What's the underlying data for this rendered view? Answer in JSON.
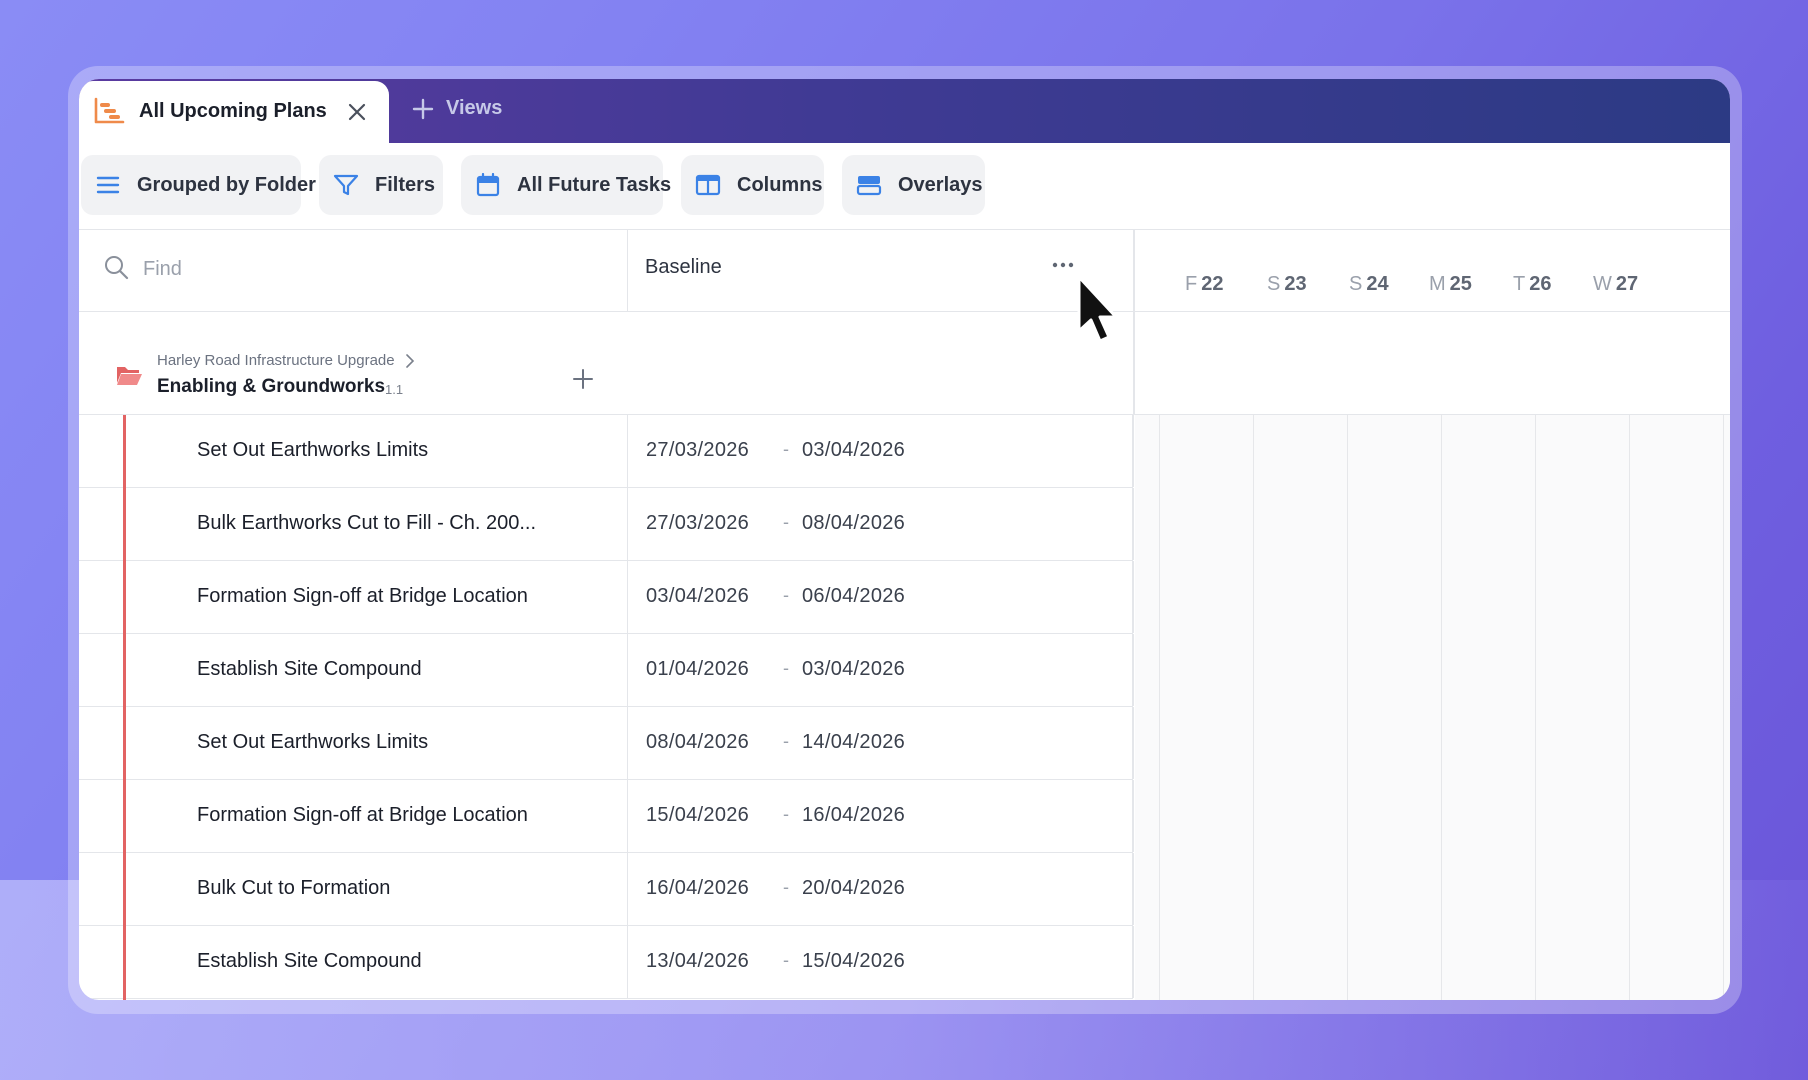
{
  "tab": {
    "active_label": "All Upcoming Plans",
    "views_label": "Views"
  },
  "toolbar": {
    "grouped_label": "Grouped by Folder",
    "filters_label": "Filters",
    "future_label": "All Future Tasks",
    "columns_label": "Columns",
    "overlays_label": "Overlays"
  },
  "search": {
    "placeholder": "Find"
  },
  "columns": {
    "baseline_label": "Baseline"
  },
  "timeline": {
    "days": [
      {
        "letter": "F",
        "num": "22"
      },
      {
        "letter": "S",
        "num": "23"
      },
      {
        "letter": "S",
        "num": "24"
      },
      {
        "letter": "M",
        "num": "25"
      },
      {
        "letter": "T",
        "num": "26"
      },
      {
        "letter": "W",
        "num": "27"
      }
    ]
  },
  "folder": {
    "breadcrumb": "Harley Road Infrastructure Upgrade",
    "title": "Enabling & Groundworks",
    "number": "1.1"
  },
  "tasks": [
    {
      "name": "Set Out Earthworks Limits",
      "start": "27/03/2026",
      "end": "03/04/2026"
    },
    {
      "name": "Bulk Earthworks Cut to Fill - Ch. 200...",
      "start": "27/03/2026",
      "end": "08/04/2026"
    },
    {
      "name": "Formation Sign-off at Bridge Location",
      "start": "03/04/2026",
      "end": "06/04/2026"
    },
    {
      "name": "Establish Site Compound",
      "start": "01/04/2026",
      "end": "03/04/2026"
    },
    {
      "name": "Set Out Earthworks Limits",
      "start": "08/04/2026",
      "end": "14/04/2026"
    },
    {
      "name": "Formation Sign-off at Bridge Location",
      "start": "15/04/2026",
      "end": "16/04/2026"
    },
    {
      "name": "Bulk Cut to Formation",
      "start": "16/04/2026",
      "end": "20/04/2026"
    },
    {
      "name": "Establish Site Compound",
      "start": "13/04/2026",
      "end": "15/04/2026"
    }
  ],
  "date_separator": "-",
  "colors": {
    "accent_orange": "#ef8a4a",
    "folder_red": "#e26363",
    "icon_blue": "#3b82e6"
  }
}
